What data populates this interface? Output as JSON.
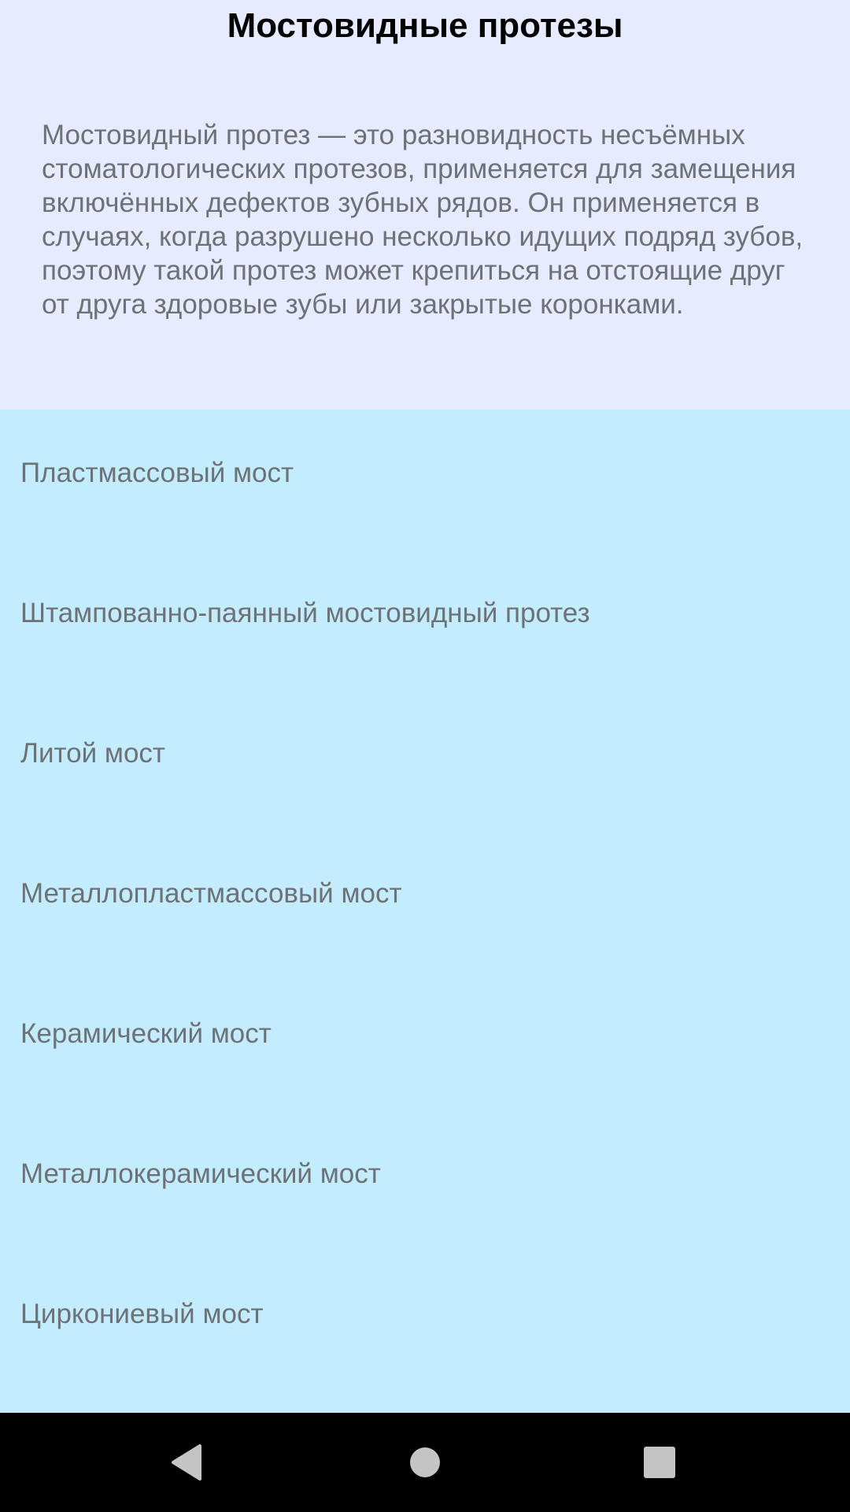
{
  "header": {
    "title": "Мостовидные протезы",
    "description": "Мостовидный протез — это разновидность несъёмных стоматологических протезов, применяется для замещения включённых дефектов зубных рядов. Он применяется в случаях, когда разрушено несколько идущих подряд зубов, поэтому такой протез может крепиться на отстоящие друг от друга здоровые зубы или закрытые коронками."
  },
  "list": {
    "items": [
      {
        "label": "Пластмассовый мост"
      },
      {
        "label": "Штампованно-паянный мостовидный протез"
      },
      {
        "label": "Литой мост"
      },
      {
        "label": "Металлопластмассовый мост"
      },
      {
        "label": "Керамический мост"
      },
      {
        "label": "Металлокерамический мост"
      },
      {
        "label": "Циркониевый мост"
      }
    ]
  },
  "navbar": {
    "back_icon": "back-triangle-icon",
    "home_icon": "home-circle-icon",
    "recents_icon": "recents-square-icon"
  },
  "colors": {
    "header_bg": "#e7ebff",
    "list_bg": "#c3ecfe",
    "text": "#6d7277",
    "nav_bg": "#000000",
    "nav_icon": "#c4c4c4"
  }
}
